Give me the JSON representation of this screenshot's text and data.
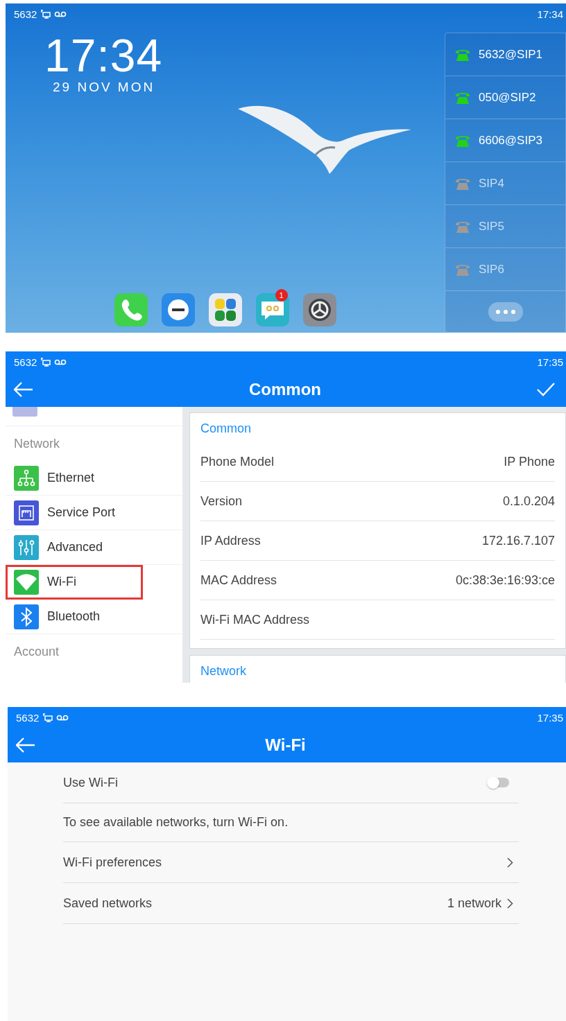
{
  "home_screen": {
    "status_bar": {
      "account": "5632",
      "time": "17:34"
    },
    "clock": {
      "time": "17:34",
      "date": "29 NOV MON"
    },
    "lines": [
      {
        "label": "5632@SIP1",
        "registered": true
      },
      {
        "label": "050@SIP2",
        "registered": true
      },
      {
        "label": "6606@SIP3",
        "registered": true
      },
      {
        "label": "SIP4",
        "registered": false
      },
      {
        "label": "SIP5",
        "registered": false
      },
      {
        "label": "SIP6",
        "registered": false
      }
    ],
    "dock": [
      {
        "kind": "phone"
      },
      {
        "kind": "dnd"
      },
      {
        "kind": "apps"
      },
      {
        "kind": "messages",
        "badge": "1"
      },
      {
        "kind": "settings"
      }
    ]
  },
  "common_screen": {
    "status_bar": {
      "account": "5632",
      "time": "17:35"
    },
    "title": "Common",
    "sidebar": {
      "sections": [
        {
          "heading": "Network",
          "items": [
            {
              "kind": "ethernet",
              "label": "Ethernet",
              "selected": false
            },
            {
              "kind": "service_port",
              "label": "Service Port",
              "selected": false
            },
            {
              "kind": "advanced",
              "label": "Advanced",
              "selected": false
            },
            {
              "kind": "wifi",
              "label": "Wi-Fi",
              "selected": true
            },
            {
              "kind": "bluetooth",
              "label": "Bluetooth",
              "selected": false
            }
          ]
        },
        {
          "heading": "Account"
        }
      ]
    },
    "panels": [
      {
        "heading": "Common",
        "rows": [
          {
            "label": "Phone Model",
            "value": "IP Phone"
          },
          {
            "label": "Version",
            "value": "0.1.0.204"
          },
          {
            "label": "IP Address",
            "value": "172.16.7.107"
          },
          {
            "label": "MAC Address",
            "value": "0c:38:3e:16:93:ce"
          },
          {
            "label": "Wi-Fi MAC Address"
          }
        ]
      },
      {
        "heading": "Network"
      }
    ]
  },
  "wifi_screen": {
    "status_bar": {
      "account": "5632",
      "time": "17:35"
    },
    "title": "Wi-Fi",
    "use_wifi": {
      "label": "Use Wi-Fi",
      "on": false
    },
    "hint": "To see available networks, turn Wi-Fi on.",
    "rows": [
      {
        "label": "Wi-Fi preferences"
      },
      {
        "label": "Saved networks",
        "value": "1 network"
      }
    ]
  }
}
